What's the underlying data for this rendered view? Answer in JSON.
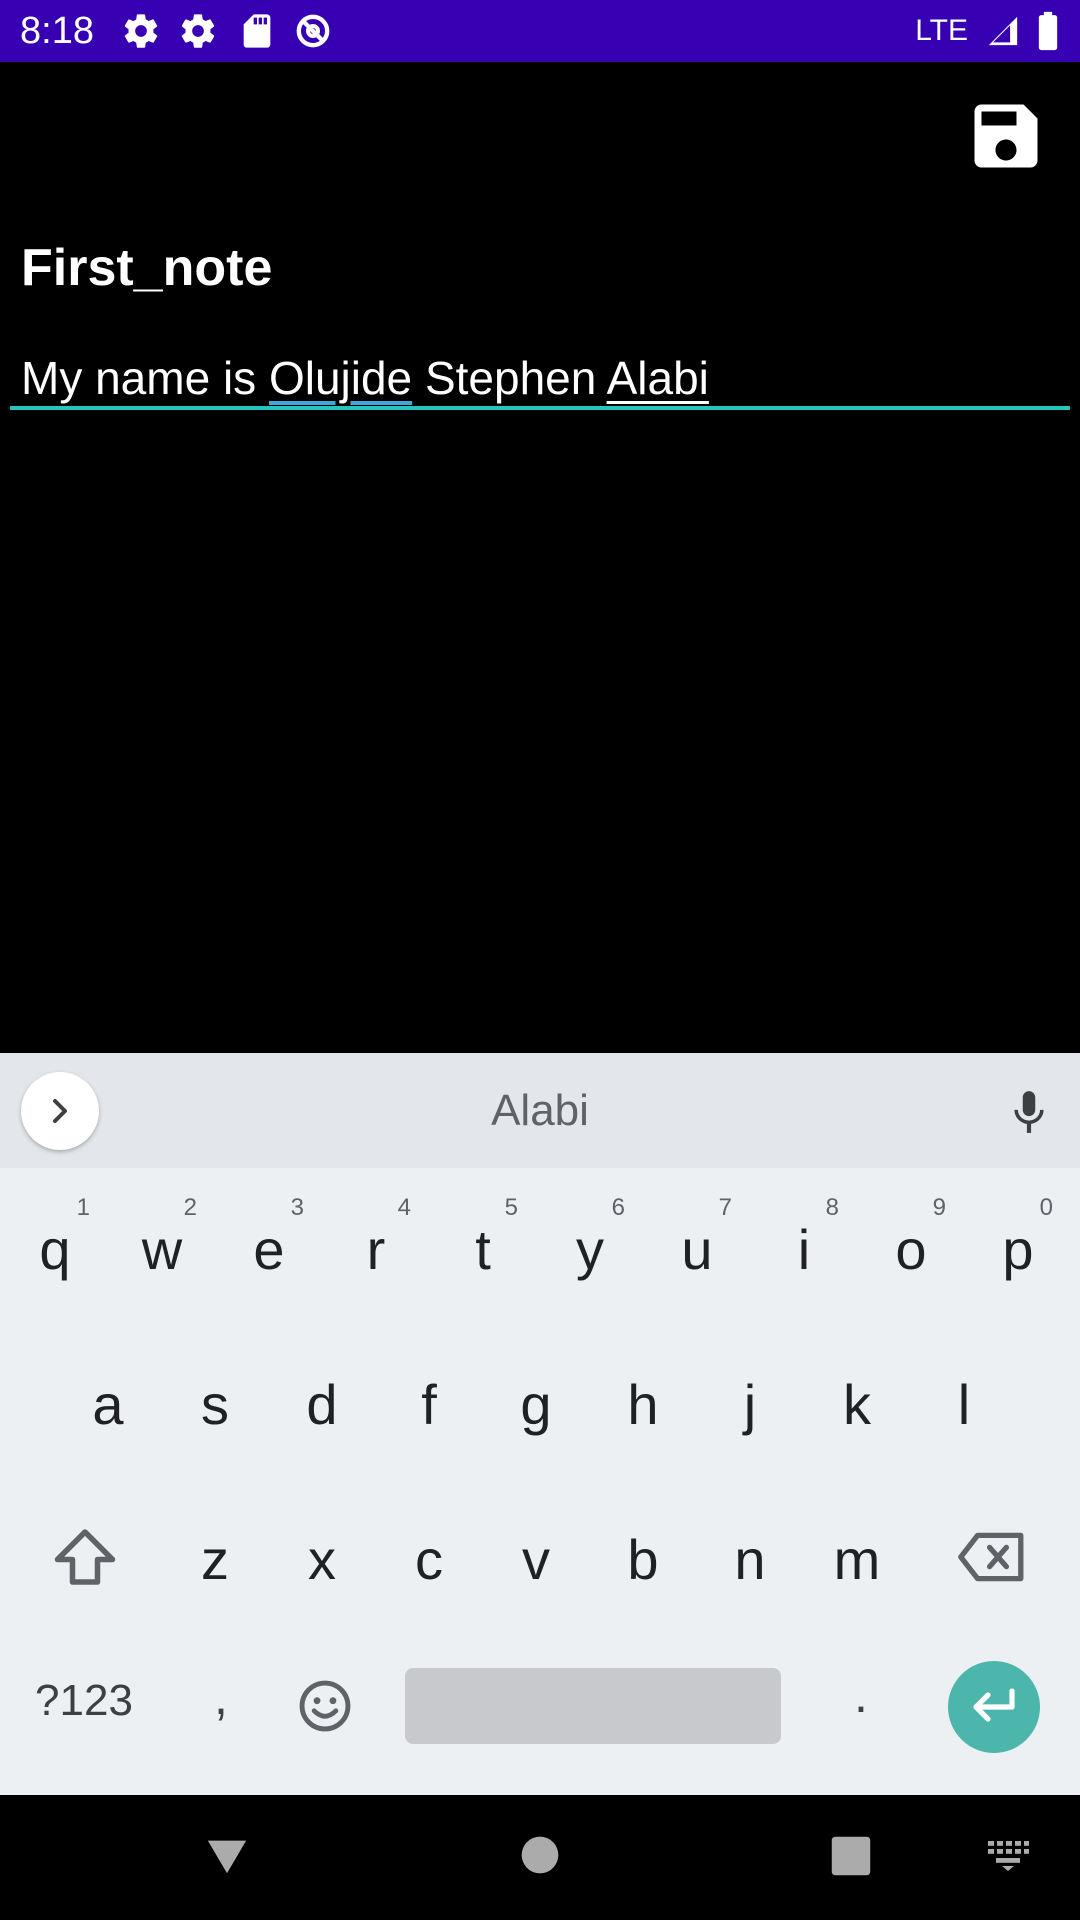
{
  "status_bar": {
    "time": "8:18",
    "network": "LTE",
    "icons": [
      "settings-icon",
      "settings-icon",
      "sd-card-icon",
      "data-saver-icon",
      "signal-icon",
      "battery-icon"
    ],
    "background": "#3700b3"
  },
  "app": {
    "save_icon": "save-icon",
    "note_title": "First_note",
    "note_body": {
      "words": [
        "My name is",
        "Olujide",
        "Stephen",
        "Alabi"
      ]
    },
    "underline_color": "#26c6c0"
  },
  "keyboard": {
    "suggestion": "Alabi",
    "rows": [
      [
        {
          "k": "q",
          "h": "1"
        },
        {
          "k": "w",
          "h": "2"
        },
        {
          "k": "e",
          "h": "3"
        },
        {
          "k": "r",
          "h": "4"
        },
        {
          "k": "t",
          "h": "5"
        },
        {
          "k": "y",
          "h": "6"
        },
        {
          "k": "u",
          "h": "7"
        },
        {
          "k": "i",
          "h": "8"
        },
        {
          "k": "o",
          "h": "9"
        },
        {
          "k": "p",
          "h": "0"
        }
      ],
      [
        {
          "k": "a"
        },
        {
          "k": "s"
        },
        {
          "k": "d"
        },
        {
          "k": "f"
        },
        {
          "k": "g"
        },
        {
          "k": "h"
        },
        {
          "k": "j"
        },
        {
          "k": "k"
        },
        {
          "k": "l"
        }
      ],
      [
        {
          "k": "z"
        },
        {
          "k": "x"
        },
        {
          "k": "c"
        },
        {
          "k": "v"
        },
        {
          "k": "b"
        },
        {
          "k": "n"
        },
        {
          "k": "m"
        }
      ]
    ],
    "symbols_label": "?123",
    "comma_label": ",",
    "period_label": ".",
    "enter_color": "#4db6ac"
  },
  "nav_bar": {
    "buttons": [
      "back-icon",
      "home-icon",
      "recents-icon",
      "keyboard-switch-icon"
    ]
  }
}
